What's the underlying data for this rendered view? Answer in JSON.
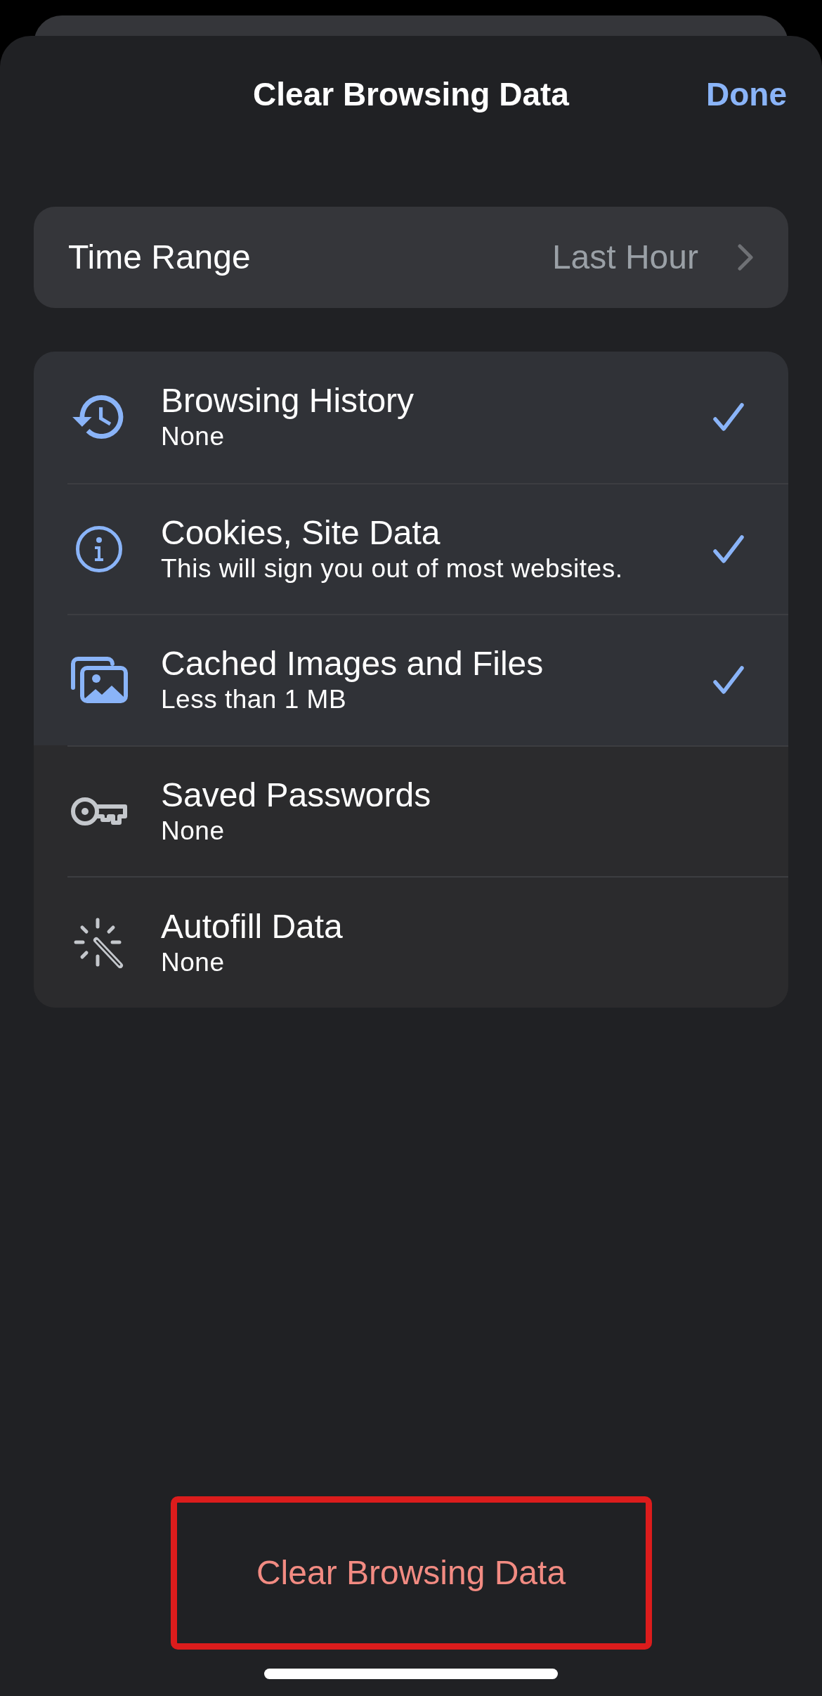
{
  "header": {
    "title": "Clear Browsing Data",
    "done": "Done"
  },
  "time_range": {
    "label": "Time Range",
    "value": "Last Hour"
  },
  "data_types": [
    {
      "kind": "history",
      "title": "Browsing History",
      "detail": "None",
      "checked": true
    },
    {
      "kind": "cookies",
      "title": "Cookies, Site Data",
      "detail": "This will sign you out of most websites.",
      "checked": true
    },
    {
      "kind": "cache",
      "title": "Cached Images and Files",
      "detail": "Less than 1 MB",
      "checked": true
    },
    {
      "kind": "passwords",
      "title": "Saved Passwords",
      "detail": "None",
      "checked": false
    },
    {
      "kind": "autofill",
      "title": "Autofill Data",
      "detail": "None",
      "checked": false
    }
  ],
  "clear_button": {
    "label": "Clear Browsing Data"
  }
}
